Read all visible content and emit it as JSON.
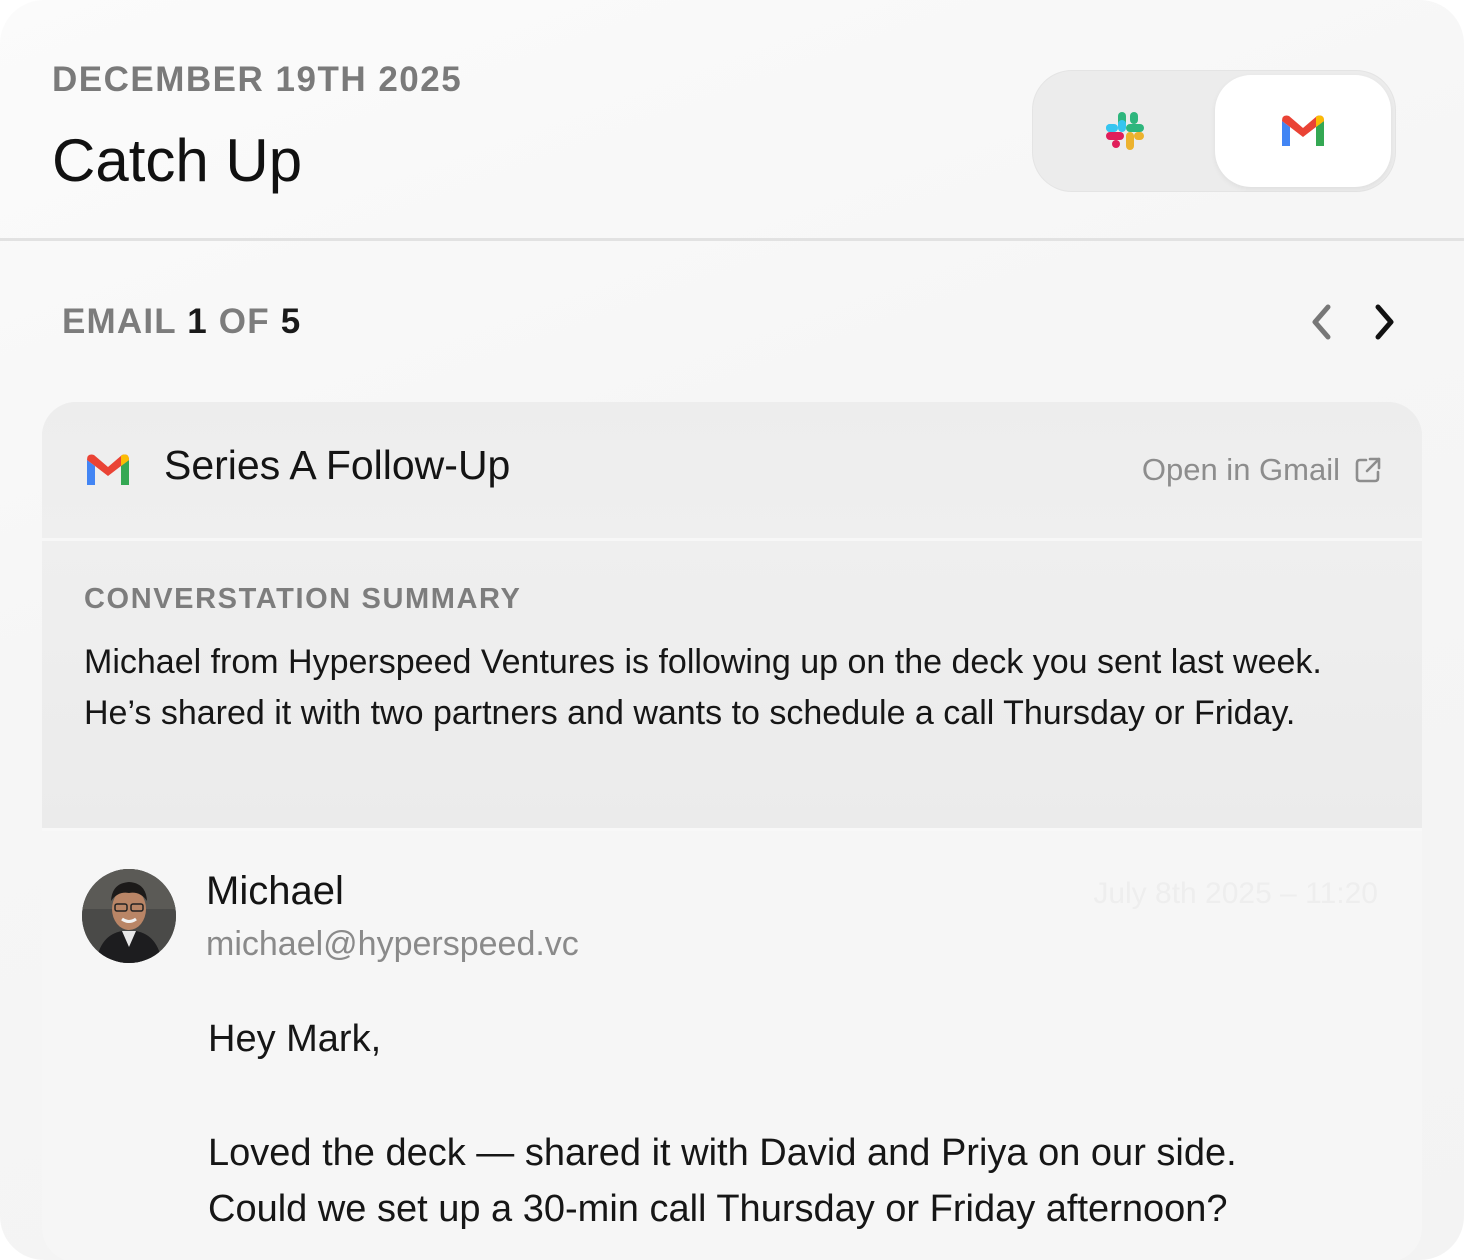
{
  "header": {
    "date": "DECEMBER 19TH 2025",
    "title": "Catch Up"
  },
  "source_switcher": {
    "options": [
      {
        "name": "Slack",
        "icon": "slack-icon",
        "selected": false
      },
      {
        "name": "Gmail",
        "icon": "gmail-icon",
        "selected": true
      }
    ]
  },
  "counter": {
    "label": "EMAIL",
    "current": "1",
    "of_label": "OF",
    "total": "5"
  },
  "email": {
    "subject": "Series A Follow-Up",
    "open_link": "Open in Gmail",
    "summary_label": "CONVERSTATION SUMMARY",
    "summary_text": "Michael from Hyperspeed Ventures is following up on the deck you sent last week. He’s shared it with two partners and wants to schedule a call Thursday or Friday.",
    "sender": {
      "name": "Michael",
      "email": "michael@hyperspeed.vc",
      "timestamp": "July 8th 2025 – 11:20"
    },
    "body": {
      "greeting": "Hey Mark,",
      "line1": "Loved the deck — shared it with David and Priya on our side.",
      "line2": "Could we set up a 30-min call Thursday or Friday afternoon?"
    }
  },
  "colors": {
    "gmail_red": "#EA4335",
    "gmail_blue": "#4285F4",
    "gmail_green": "#34A853",
    "gmail_yellow": "#FBBC04",
    "slack_blue": "#36C5F0",
    "slack_green": "#2EB67D",
    "slack_red": "#E01E5A",
    "slack_yellow": "#ECB22E"
  }
}
